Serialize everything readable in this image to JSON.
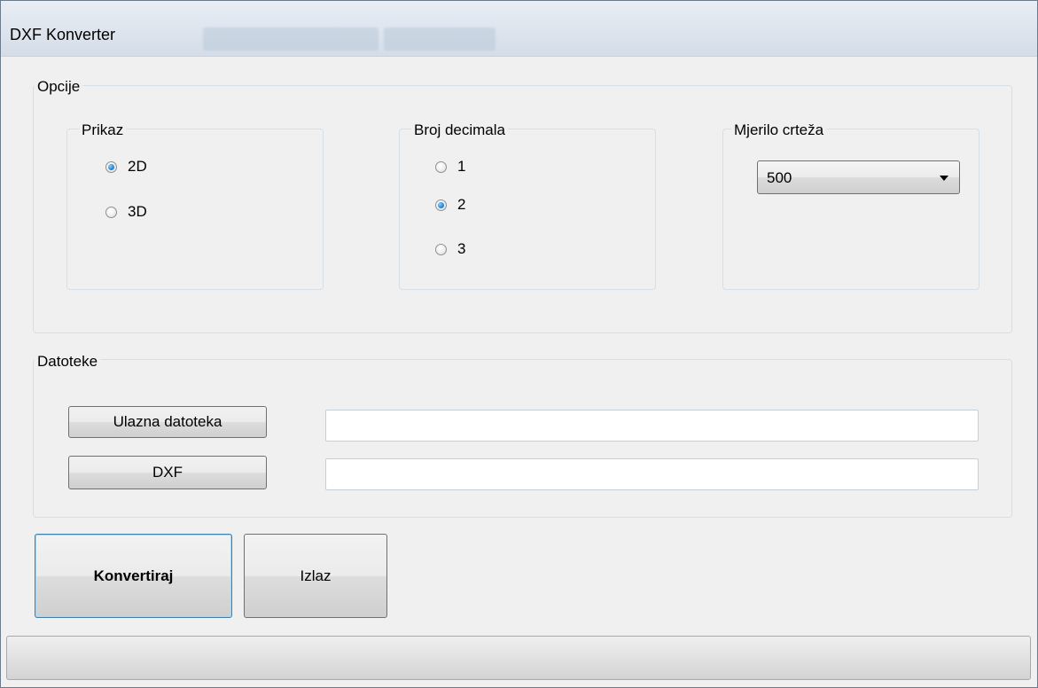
{
  "window": {
    "title": "DXF Konverter"
  },
  "options": {
    "label": "Opcije",
    "display": {
      "label": "Prikaz",
      "items": [
        {
          "label": "2D",
          "checked": true
        },
        {
          "label": "3D",
          "checked": false
        }
      ]
    },
    "decimals": {
      "label": "Broj decimala",
      "items": [
        {
          "label": "1",
          "checked": false
        },
        {
          "label": "2",
          "checked": true
        },
        {
          "label": "3",
          "checked": false
        }
      ]
    },
    "scale": {
      "label": "Mjerilo crteža",
      "value": "500"
    }
  },
  "files": {
    "label": "Datoteke",
    "input_button": "Ulazna datoteka",
    "input_value": "",
    "dxf_button": "DXF",
    "dxf_value": ""
  },
  "actions": {
    "convert": "Konvertiraj",
    "exit": "Izlaz"
  }
}
